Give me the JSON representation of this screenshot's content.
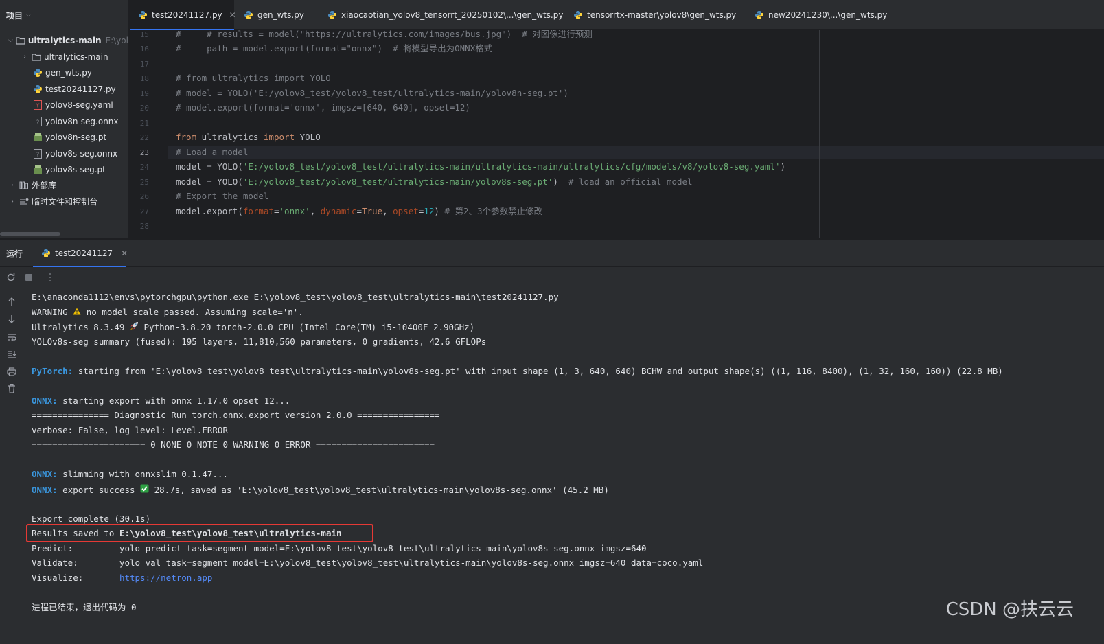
{
  "sidebar": {
    "title": "项目",
    "root": {
      "label": "ultralytics-main",
      "hint": "E:\\yolo"
    },
    "items": [
      {
        "label": "ultralytics-main",
        "kind": "folder"
      },
      {
        "label": "gen_wts.py",
        "kind": "python"
      },
      {
        "label": "test20241127.py",
        "kind": "python"
      },
      {
        "label": "yolov8-seg.yaml",
        "kind": "yaml"
      },
      {
        "label": "yolov8n-seg.onnx",
        "kind": "unknown"
      },
      {
        "label": "yolov8n-seg.pt",
        "kind": "pt"
      },
      {
        "label": "yolov8s-seg.onnx",
        "kind": "unknown"
      },
      {
        "label": "yolov8s-seg.pt",
        "kind": "pt"
      }
    ],
    "external": "外部库",
    "scratches": "临时文件和控制台"
  },
  "tabs": [
    {
      "label": "test20241127.py",
      "active": true
    },
    {
      "label": "gen_wts.py"
    },
    {
      "label": "xiaocaotian_yolov8_tensorrt_20250102\\...\\gen_wts.py"
    },
    {
      "label": "tensorrtx-master\\yolov8\\gen_wts.py"
    },
    {
      "label": "new20241230\\...\\gen_wts.py"
    }
  ],
  "editor": {
    "line_numbers": [
      "15",
      "16",
      "17",
      "18",
      "19",
      "20",
      "21",
      "22",
      "23",
      "24",
      "25",
      "26",
      "27",
      "28"
    ],
    "current_line": "23",
    "lines": {
      "l15": {
        "a": "#     # results = model(\"",
        "url": "https://ultralytics.com/images/bus.jpg",
        "b": "\")  # 对图像进行预测"
      },
      "l16": "#     path = model.export(format=\"onnx\")  # 将模型导出为ONNX格式",
      "l18": "# from ultralytics import YOLO",
      "l19": "# model = YOLO('E:/yolov8_test/yolov8_test/ultralytics-main/yolov8n-seg.pt')",
      "l20": "# model.export(format='onnx', imgsz=[640, 640], opset=12)",
      "l22": {
        "kw1": "from",
        "mid": " ultralytics ",
        "kw2": "import",
        "end": " YOLO"
      },
      "l23": "# Load a model",
      "l24": {
        "a": "model = YOLO(",
        "str": "'E:/yolov8_test/yolov8_test/ultralytics-main/ultralytics-main/ultralytics/cfg/models/v8/yolov8-seg.yaml'",
        "b": ")"
      },
      "l25": {
        "a": "model = YOLO(",
        "str": "'E:/yolov8_test/yolov8_test/ultralytics-main/yolov8s-seg.pt'",
        "b": ")  ",
        "cmt": "# load an official model"
      },
      "l26": "# Export the model",
      "l27": {
        "a": "model.export(",
        "p1": "format",
        "eq1": "=",
        "v1": "'onnx'",
        "s1": ", ",
        "p2": "dynamic",
        "eq2": "=",
        "v2": "True",
        "s2": ", ",
        "p3": "opset",
        "eq3": "=",
        "v3": "12",
        "b": ") ",
        "cmt": "# 第2、3个参数禁止修改"
      }
    }
  },
  "run": {
    "title": "运行",
    "tab": "test20241127"
  },
  "console": {
    "l1": "E:\\anaconda1112\\envs\\pytorchgpu\\python.exe E:\\yolov8_test\\yolov8_test\\ultralytics-main\\test20241127.py",
    "l2a": "WARNING ",
    "l2b": " no model scale passed. Assuming scale='n'.",
    "l3a": "Ultralytics 8.3.49 ",
    "l3b": " Python-3.8.20 torch-2.0.0 CPU (Intel Core(TM) i5-10400F 2.90GHz)",
    "l4": "YOLOv8s-seg summary (fused): 195 layers, 11,810,560 parameters, 0 gradients, 42.6 GFLOPs",
    "l5a": "PyTorch:",
    "l5b": " starting from 'E:\\yolov8_test\\yolov8_test\\ultralytics-main\\yolov8s-seg.pt' with input shape (1, 3, 640, 640) BCHW and output shape(s) ((1, 116, 8400), (1, 32, 160, 160)) (22.8 MB)",
    "l6a": "ONNX:",
    "l6b": " starting export with onnx 1.17.0 opset 12...",
    "l7": "=============== Diagnostic Run torch.onnx.export version 2.0.0 ================",
    "l8": "verbose: False, log level: Level.ERROR",
    "l9": "====================== 0 NONE 0 NOTE 0 WARNING 0 ERROR =======================",
    "l10a": "ONNX:",
    "l10b": " slimming with onnxslim 0.1.47...",
    "l11a": "ONNX:",
    "l11b": " export success ",
    "l11c": " 28.7s, saved as 'E:\\yolov8_test\\yolov8_test\\ultralytics-main\\yolov8s-seg.onnx' (45.2 MB)",
    "l12": "Export complete (30.1s)",
    "l13a": "Results saved to ",
    "l13b": "E:\\yolov8_test\\yolov8_test\\ultralytics-main",
    "l14": "Predict:         yolo predict task=segment model=E:\\yolov8_test\\yolov8_test\\ultralytics-main\\yolov8s-seg.onnx imgsz=640",
    "l15": "Validate:        yolo val task=segment model=E:\\yolov8_test\\yolov8_test\\ultralytics-main\\yolov8s-seg.onnx imgsz=640 data=coco.yaml",
    "l16a": "Visualize:       ",
    "l16b": "https://netron.app",
    "l17": "进程已结束，退出代码为 0"
  },
  "watermark": "CSDN @扶云云",
  "colors": {
    "accent": "#3574f0",
    "highlight_box": "#e53935",
    "console_blue": "#3a96dd",
    "string": "#6aab73",
    "keyword": "#cf8e6d",
    "comment": "#7a7e85"
  }
}
